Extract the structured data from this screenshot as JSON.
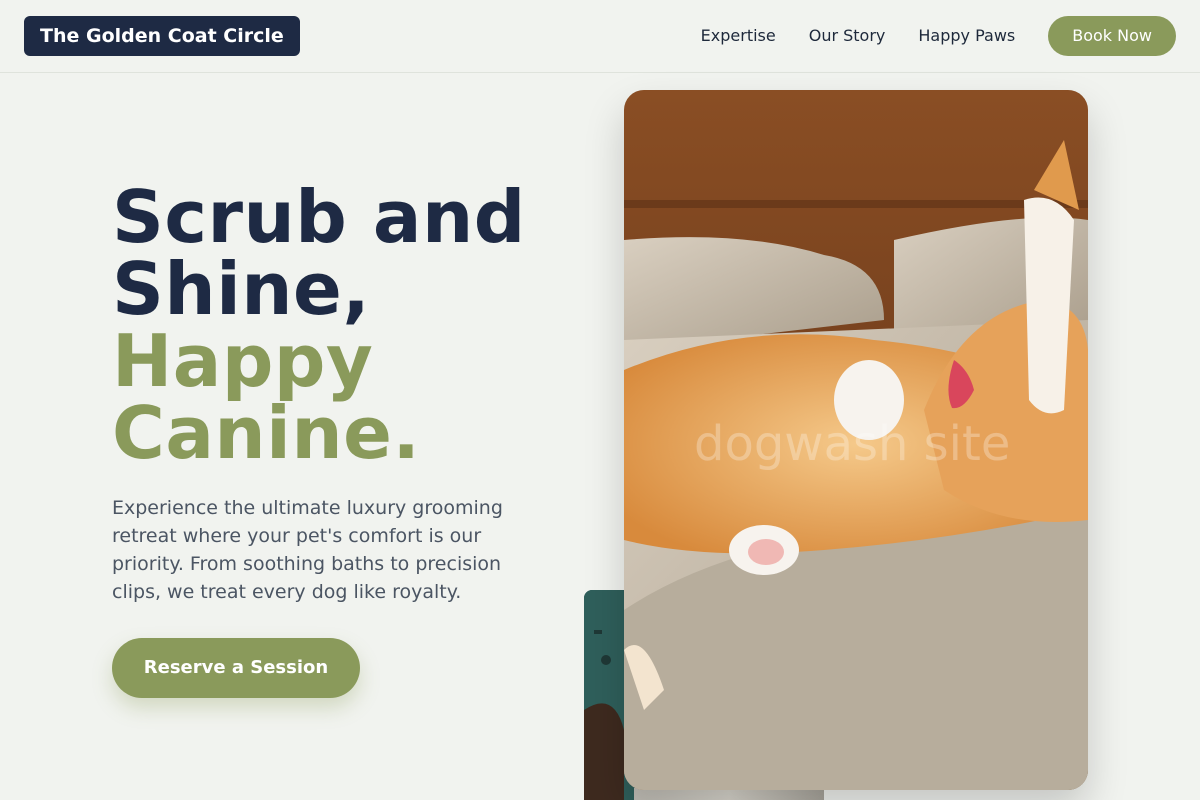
{
  "header": {
    "logo": "The Golden Coat Circle",
    "nav": [
      "Expertise",
      "Our Story",
      "Happy Paws"
    ],
    "cta": "Book Now"
  },
  "hero": {
    "title_dark": [
      "Scrub and",
      "Shine,"
    ],
    "title_accent": [
      "Happy",
      "Canine."
    ],
    "description": "Experience the ultimate luxury grooming retreat where your pet's comfort is our priority. From soothing baths to precision clips, we treat every dog like royalty.",
    "button": "Reserve a Session"
  },
  "images": {
    "main_watermark": "dogwash site"
  },
  "colors": {
    "primary_dark": "#1e2a44",
    "accent_green": "#8a9a5b",
    "background": "#f1f3ef"
  }
}
